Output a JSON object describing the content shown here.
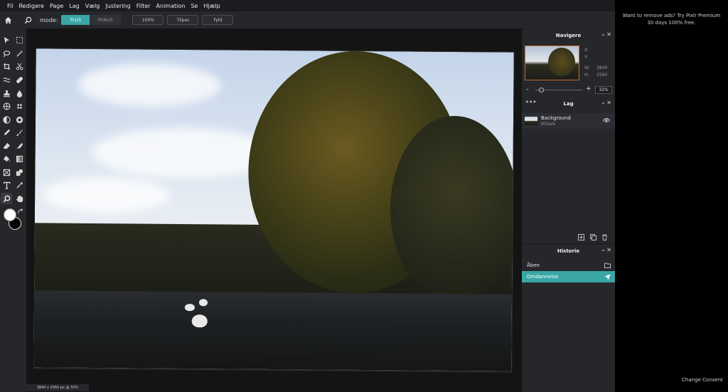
{
  "menu": [
    "Fil",
    "Redigere",
    "Page",
    "Lag",
    "Vælg",
    "Justering",
    "Filter",
    "Animation",
    "Se",
    "Hjælp"
  ],
  "options": {
    "mode_label": "mode:",
    "plus_label": "PLUS",
    "minus_label": "MINUS",
    "zoom_100": "100%",
    "fit_label": "Tilpas",
    "fill_label": "Fyld"
  },
  "navigator": {
    "title": "Navigere",
    "x_label": "X:",
    "y_label": "Y:",
    "w_label": "W:",
    "w_value": "3840",
    "h_label": "H:",
    "h_value": "2560",
    "minus": "-",
    "plus": "+",
    "zoom": "32%",
    "zoom_level": 0.32
  },
  "layers": {
    "title": "Lag",
    "items": [
      {
        "name": "Background",
        "type": "Billede"
      }
    ]
  },
  "history": {
    "title": "Historie",
    "items": [
      {
        "label": "Åben",
        "icon": "folder-icon",
        "active": false
      },
      {
        "label": "Omdannelse",
        "icon": "move-arrow-icon",
        "active": true
      }
    ]
  },
  "status": "3840 x 2560 px @ 32%",
  "ad": {
    "text": "Want to remove ads? Try Pixlr Premium 30 days 100% free.",
    "consent": "Change Consent"
  },
  "colors": {
    "accent": "#3aa6a6",
    "primary_swatch": "#ffffff",
    "secondary_swatch": "#000000"
  }
}
